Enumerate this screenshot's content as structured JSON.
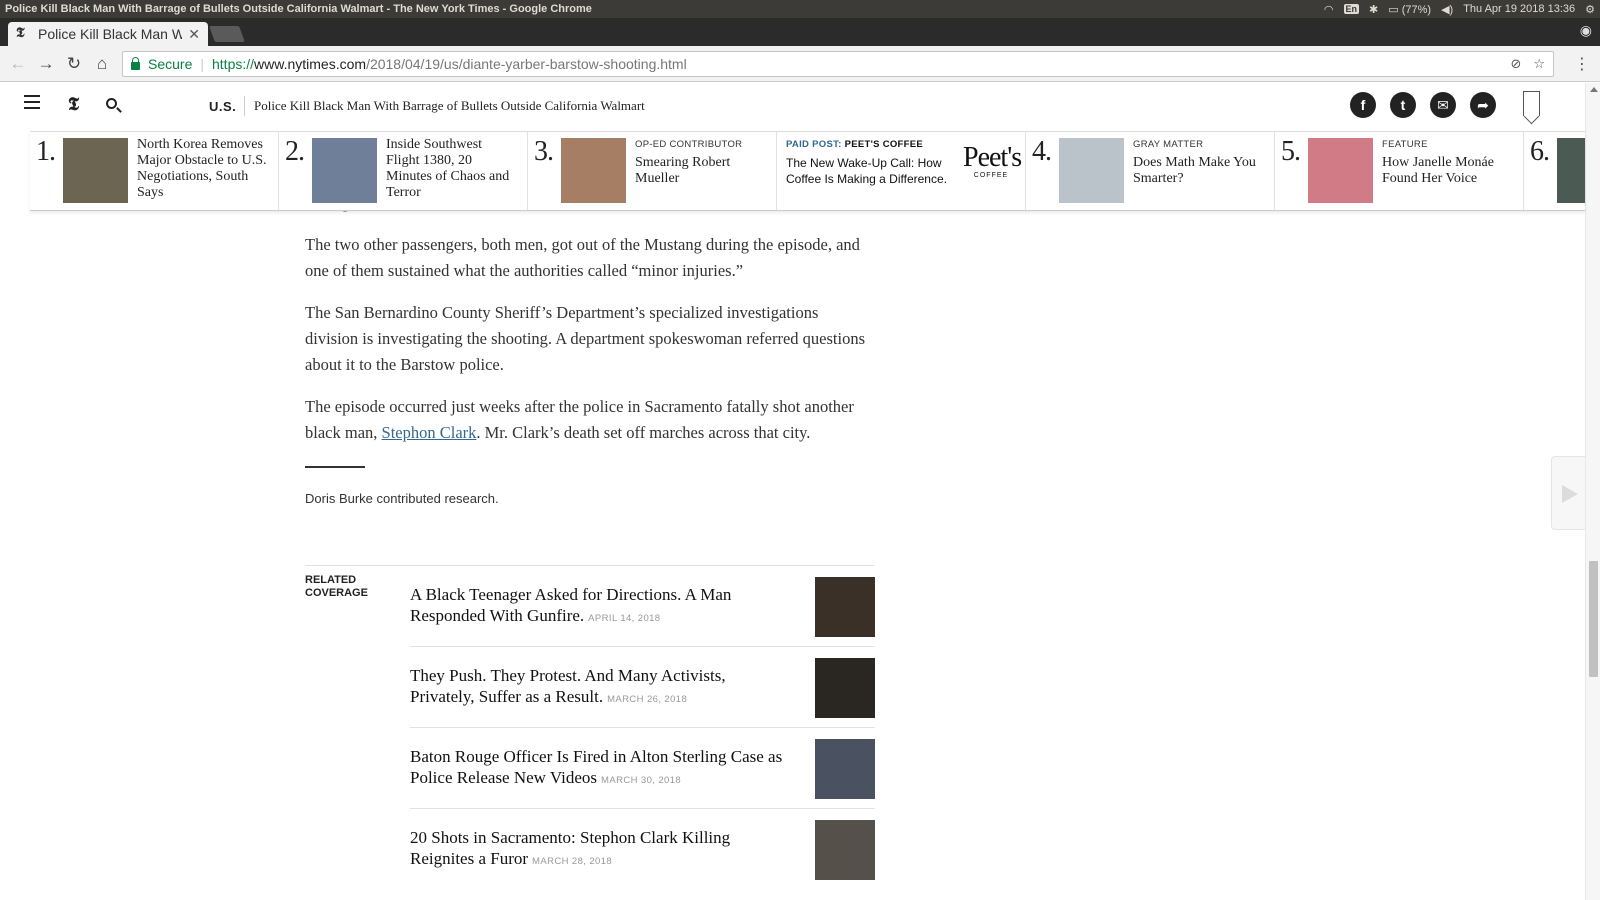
{
  "os": {
    "window_title": "Police Kill Black Man With Barrage of Bullets Outside California Walmart - The New York Times - Google Chrome",
    "lang": "En",
    "battery": "(77%)",
    "datetime": "Thu Apr 19 2018 13:36"
  },
  "browser": {
    "tab_title": "Police Kill Black Man With Barrage of Bullets Outside California Walmart",
    "secure_label": "Secure",
    "url_scheme": "https://",
    "url_host": "www.nytimes.com",
    "url_path": "/2018/04/19/us/diante-yarber-barstow-shooting.html"
  },
  "header": {
    "logo": "𝕿",
    "section": "U.S.",
    "title": "Police Kill Black Man With Barrage of Bullets Outside California Walmart",
    "share_icons": [
      "f",
      "t",
      "✉",
      "➦"
    ]
  },
  "ribbon": [
    {
      "num": "1.",
      "kicker": "",
      "title": "North Korea Removes Major Obstacle to U.S. Negotiations, South Says",
      "thumb_color": "#6b6552"
    },
    {
      "num": "2.",
      "kicker": "",
      "title": "Inside Southwest Flight 1380, 20 Minutes of Chaos and Terror",
      "thumb_color": "#6f7f9a"
    },
    {
      "num": "3.",
      "kicker": "OP-ED CONTRIBUTOR",
      "title": "Smearing Robert Mueller",
      "thumb_color": "#a67e64"
    },
    {
      "num": "",
      "kicker_prefix": "PAID POST:",
      "kicker": "PEET'S COFFEE",
      "title": "The New Wake-Up Call: How Coffee Is Making a Difference.",
      "logo": "Peet's",
      "logo_sub": "COFFEE"
    },
    {
      "num": "4.",
      "kicker": "GRAY MATTER",
      "title": "Does Math Make You Smarter?",
      "thumb_color": "#b9c3c9"
    },
    {
      "num": "5.",
      "kicker": "FEATURE",
      "title": "How Janelle Monáe Found Her Voice",
      "thumb_color": "#d17b86"
    },
    {
      "num": "6.",
      "kicker": "",
      "title": "",
      "thumb_color": "#4b5a52"
    }
  ],
  "article": {
    "fragment": "the leg.",
    "paragraphs": [
      "The two other passengers, both men, got out of the Mustang during the episode, and one of them sustained what the authorities called “minor injuries.”",
      "The San Bernardino County Sheriff’s Department’s specialized investigations division is investigating the shooting. A department spokeswoman referred questions about it to the Barstow police."
    ],
    "last_pre": "The episode occurred just weeks after the police in Sacramento fatally shot another black man, ",
    "last_link": "Stephon Clark",
    "last_post": ". Mr. Clark’s death set off marches across that city.",
    "credit": "Doris Burke contributed research."
  },
  "related": {
    "label": "RELATED COVERAGE",
    "items": [
      {
        "headline": "A Black Teenager Asked for Directions. A Man Responded With Gunfire.",
        "date": "APRIL 14, 2018",
        "thumb_color": "#3a3028"
      },
      {
        "headline": "They Push. They Protest. And Many Activists, Privately, Suffer as a Result.",
        "date": "MARCH 26, 2018",
        "thumb_color": "#2a2622"
      },
      {
        "headline": "Baton Rouge Officer Is Fired in Alton Sterling Case as Police Release New Videos",
        "date": "MARCH 30, 2018",
        "thumb_color": "#4a5262"
      },
      {
        "headline": "20 Shots in Sacramento: Stephon Clark Killing Reignites a Furor",
        "date": "MARCH 28, 2018",
        "thumb_color": "#55504a"
      }
    ]
  }
}
